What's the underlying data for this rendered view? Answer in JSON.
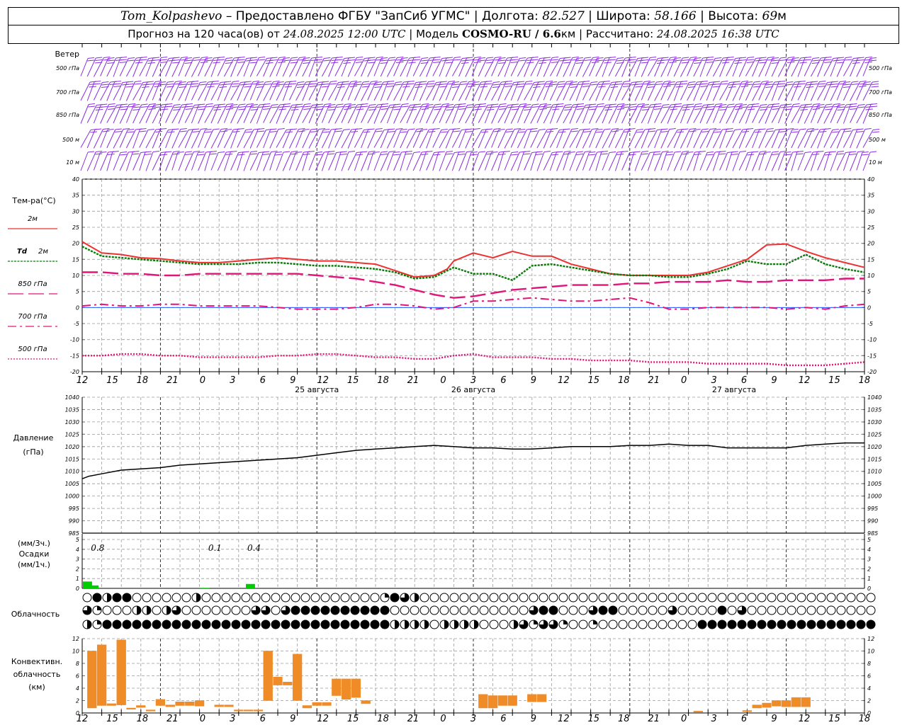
{
  "header": {
    "station": "Tom_Kolpashevo",
    "provider": " – Предоставлено ФГБУ \"ЗапСиб УГМС\" | Долгота: ",
    "lon": "82.527",
    "lat_label": " | Широта: ",
    "lat": "58.166",
    "alt_label": " | Высота: ",
    "alt": "69",
    "alt_unit": "м",
    "fc_label": "Прогноз на 120 часа(ов) от ",
    "fc_start": "24.08.2025 12:00 UTC",
    "model_label": " | Модель ",
    "model": "COSMO-RU / 6.6",
    "model_unit": "км",
    "calc_label": " | Рассчитано: ",
    "calc_time": "24.08.2025 16:38 UTC"
  },
  "colors": {
    "wind": "#8a2be2",
    "t2m": "#ee3030",
    "td2m": "#0a7a0a",
    "t850": "#e0147a",
    "t700": "#e0147a",
    "t500": "#e0147a",
    "pressure": "#000000",
    "precip": "#00cc00",
    "convective": "#f08c28",
    "zero_line": "#1e5aff"
  },
  "chart_data": [
    {
      "type": "wind_barbs",
      "title": "Ветер",
      "levels": [
        "500 гПа",
        "700 гПа",
        "850 гПа",
        "500 м",
        "10  м"
      ],
      "x_hours": [
        0,
        120
      ]
    },
    {
      "type": "line",
      "title": "Тем-ра(°С)",
      "ylim": [
        -20,
        40
      ],
      "ytick_step": 5,
      "x_tick_labels": [
        "12",
        "15",
        "18",
        "21",
        "0",
        "3",
        "6",
        "9",
        "12",
        "15",
        "18",
        "21",
        "0",
        "3",
        "6",
        "9",
        "12",
        "15",
        "18",
        "21",
        "0",
        "3",
        "6",
        "9",
        "12",
        "15",
        "18"
      ],
      "dates": [
        {
          "label": "25 августа",
          "hour": 36
        },
        {
          "label": "26 августа",
          "hour": 60
        },
        {
          "label": "27 августа",
          "hour": 100
        }
      ],
      "legend": [
        {
          "label": "2м",
          "prefix": ""
        },
        {
          "label": "2м",
          "prefix": "Td"
        },
        {
          "label": "850 гПа",
          "prefix": ""
        },
        {
          "label": "700 гПа",
          "prefix": ""
        },
        {
          "label": "500 гПа",
          "prefix": ""
        }
      ],
      "series": [
        {
          "name": "2м",
          "x": [
            0,
            3,
            6,
            9,
            12,
            15,
            18,
            21,
            24,
            27,
            30,
            33,
            36,
            39,
            42,
            45,
            48,
            51,
            54,
            56,
            57,
            60,
            63,
            66,
            69,
            72,
            75,
            78,
            81,
            84,
            87,
            90,
            93,
            96,
            99,
            102,
            105,
            108,
            111,
            114,
            117,
            120
          ],
          "values": [
            20.5,
            17,
            16.5,
            15.5,
            15.2,
            14.5,
            14,
            14,
            14.5,
            15,
            15.5,
            15,
            14.5,
            14.5,
            14,
            13.5,
            11.5,
            9.5,
            10,
            12,
            14.5,
            17,
            15.5,
            17.5,
            16,
            16,
            13.5,
            12,
            10.5,
            10,
            10,
            10,
            10,
            11,
            13,
            15,
            19.5,
            19.8,
            17.5,
            15.5,
            14,
            12.5
          ]
        },
        {
          "name": "Td 2м",
          "x": [
            0,
            3,
            6,
            9,
            12,
            15,
            18,
            21,
            24,
            27,
            30,
            33,
            36,
            39,
            42,
            45,
            48,
            51,
            54,
            57,
            60,
            63,
            66,
            69,
            72,
            75,
            78,
            81,
            84,
            87,
            90,
            93,
            96,
            99,
            102,
            105,
            108,
            111,
            114,
            117,
            120
          ],
          "values": [
            19,
            16,
            15.5,
            15,
            14.5,
            14,
            13.5,
            13.5,
            13.5,
            14,
            14,
            13.5,
            13,
            13,
            12.5,
            12,
            11,
            9,
            9.5,
            12.5,
            10.5,
            10.5,
            8.5,
            13,
            13.5,
            12.5,
            11.5,
            10.5,
            10,
            10,
            9.5,
            9.5,
            10.5,
            12,
            14.5,
            13.5,
            13.5,
            16.5,
            13.5,
            12,
            11
          ]
        },
        {
          "name": "850 гПа",
          "x": [
            0,
            3,
            6,
            9,
            12,
            15,
            18,
            21,
            24,
            27,
            30,
            33,
            36,
            39,
            42,
            45,
            48,
            51,
            54,
            57,
            60,
            63,
            66,
            69,
            72,
            75,
            78,
            81,
            84,
            87,
            90,
            93,
            96,
            99,
            102,
            105,
            108,
            111,
            114,
            117,
            120
          ],
          "values": [
            11,
            11,
            10.5,
            10.5,
            10,
            10,
            10.5,
            10.5,
            10.5,
            10.5,
            10.5,
            10.5,
            10,
            9.5,
            9,
            8,
            7,
            5.5,
            4,
            3,
            3.5,
            4.5,
            5.5,
            6,
            6.5,
            7,
            7,
            7,
            7.5,
            7.5,
            8,
            8,
            8,
            8.5,
            8,
            8,
            8.5,
            8.5,
            8.5,
            9,
            9
          ]
        },
        {
          "name": "700 гПа",
          "x": [
            0,
            3,
            6,
            9,
            12,
            15,
            18,
            21,
            24,
            27,
            30,
            33,
            36,
            39,
            42,
            45,
            48,
            51,
            54,
            57,
            60,
            63,
            66,
            69,
            72,
            75,
            78,
            81,
            84,
            87,
            90,
            93,
            96,
            99,
            102,
            105,
            108,
            111,
            114,
            117,
            120
          ],
          "values": [
            0.5,
            1,
            0.5,
            0.5,
            1,
            1,
            0.5,
            0.5,
            0.5,
            0.5,
            0,
            -0.5,
            -0.5,
            -0.5,
            0,
            1,
            1,
            0.5,
            -0.5,
            0,
            2,
            2,
            2.5,
            3,
            2.5,
            2,
            2,
            2.5,
            3,
            1.5,
            -0.5,
            -0.5,
            0,
            0,
            0,
            0,
            -0.5,
            0,
            -0.5,
            0.5,
            1
          ]
        },
        {
          "name": "500 гПа",
          "x": [
            0,
            3,
            6,
            9,
            12,
            15,
            18,
            21,
            24,
            27,
            30,
            33,
            36,
            39,
            42,
            45,
            48,
            51,
            54,
            57,
            60,
            63,
            66,
            69,
            72,
            75,
            78,
            81,
            84,
            87,
            90,
            93,
            96,
            99,
            102,
            105,
            108,
            111,
            114,
            117,
            120
          ],
          "values": [
            -15,
            -15,
            -14.5,
            -14.5,
            -15,
            -15,
            -15.5,
            -15.5,
            -15.5,
            -15.5,
            -15,
            -15,
            -14.5,
            -14.5,
            -15,
            -15.5,
            -15.5,
            -16,
            -16,
            -15,
            -14.5,
            -15.5,
            -15.5,
            -15.5,
            -16,
            -16,
            -16.5,
            -16.5,
            -16.5,
            -17,
            -17,
            -17,
            -17.5,
            -17.5,
            -17.5,
            -17.5,
            -18,
            -18,
            -18,
            -17.5,
            -17
          ]
        }
      ]
    },
    {
      "type": "line",
      "title_lines": [
        "Давление",
        "(гПа)"
      ],
      "ylim": [
        985,
        1040
      ],
      "ytick_step": 5,
      "series": [
        {
          "x": [
            0,
            1,
            3,
            6,
            9,
            12,
            15,
            18,
            21,
            24,
            27,
            30,
            33,
            36,
            39,
            42,
            45,
            48,
            51,
            54,
            57,
            60,
            63,
            66,
            69,
            72,
            75,
            78,
            81,
            84,
            87,
            90,
            93,
            96,
            99,
            102,
            105,
            108,
            111,
            114,
            117,
            120
          ],
          "values": [
            1007,
            1008,
            1009,
            1010.5,
            1011,
            1011.5,
            1012.5,
            1013,
            1013.5,
            1014,
            1014.5,
            1015,
            1015.5,
            1016.5,
            1017.5,
            1018.5,
            1019,
            1019.5,
            1020,
            1020.5,
            1020,
            1019.5,
            1019.5,
            1019,
            1019,
            1019.5,
            1020,
            1020,
            1020,
            1020.5,
            1020.5,
            1021,
            1020.5,
            1020.5,
            1019.5,
            1019.5,
            1019.5,
            1019.5,
            1020.5,
            1021,
            1021.5,
            1021.5
          ]
        }
      ]
    },
    {
      "type": "bar",
      "title_lines": [
        "(мм/3ч.)",
        "Осадки",
        "(мм/1ч.)"
      ],
      "ylim": [
        0,
        5
      ],
      "ytick_step": 1,
      "hourly_bars": [
        {
          "x": 0,
          "value": 0.7
        },
        {
          "x": 1,
          "value": 0.3
        },
        {
          "x": 18,
          "value": 0.05
        },
        {
          "x": 25,
          "value": 0.45
        }
      ],
      "totals": [
        {
          "x": 1.5,
          "label": "0.8"
        },
        {
          "x": 19.5,
          "label": "0.1"
        },
        {
          "x": 25.5,
          "label": "0.4"
        }
      ]
    },
    {
      "type": "cloud_symbols",
      "title": "Облачность",
      "rows": [
        "0 8 4 8 8 0 0 0 0 0 0 4 0 0 0 0 0 0 0 0 0 0 0 0 0 0 0 0 0 0 3 8 6 4 0 0 0 0 0 0 0 0 0 0 0 0 0 0 0 0 0 0 0 0 0 0 0 0 0 0 0 0 0 0 0 0 0 0 0 0 0 0 0 0 0 0 0 0 0 0 0",
        "6 3 0 0 0 4 4 0 4 6 0 0 0 0 0 0 0 6 6 0 6 8 8 8 8 8 8 8 8 8 8 0 0 0 0 0 0 0 0 0 0 0 0 0 0 6 8 8 0 0 0 6 8 8 0 0 0 0 0 6 0 0 0 0 8 0 6 0 0 0 0 0 0 0 0 0 0 0 0 0 0",
        "4 3 8 8 8 8 8 8 8 8 8 8 8 8 8 8 8 8 8 8 8 8 8 8 8 8 8 8 8 8 8 4 4 4 4 0 4 4 4 4 0 0 0 4 6 3 6 6 3 0 0 3 0 0 0 0 0 0 0 0 0 0 8 8 8 8 8 8 8 8 8 8 8 8 8 8 8 8 8 8 8 8 8 8 8 8 8 8 8 8 8 8 8"
      ]
    },
    {
      "type": "bar",
      "title_lines": [
        "Конвективн.",
        "облачность",
        "(км)"
      ],
      "ylim": [
        0,
        12
      ],
      "ytick_step": 2,
      "bars": [
        {
          "x": 1,
          "base": 0.8,
          "top": 10
        },
        {
          "x": 2,
          "base": 1.2,
          "top": 11
        },
        {
          "x": 3,
          "base": 1.2,
          "top": 1.5
        },
        {
          "x": 4,
          "base": 1.3,
          "top": 11.8
        },
        {
          "x": 5,
          "base": 0.6,
          "top": 0.8
        },
        {
          "x": 6,
          "base": 0.9,
          "top": 1.2
        },
        {
          "x": 7,
          "base": 0.3,
          "top": 0.5
        },
        {
          "x": 8,
          "base": 1.2,
          "top": 2.2
        },
        {
          "x": 9,
          "base": 1,
          "top": 1.3
        },
        {
          "x": 10,
          "base": 1.2,
          "top": 1.8
        },
        {
          "x": 11,
          "base": 1.2,
          "top": 1.8
        },
        {
          "x": 12,
          "base": 1.1,
          "top": 2
        },
        {
          "x": 14,
          "base": 1,
          "top": 1.3
        },
        {
          "x": 15,
          "base": 1,
          "top": 1.3
        },
        {
          "x": 16,
          "base": 0.3,
          "top": 0.5
        },
        {
          "x": 17,
          "base": 0.3,
          "top": 0.5
        },
        {
          "x": 18,
          "base": 0.3,
          "top": 0.5
        },
        {
          "x": 19,
          "base": 2,
          "top": 10
        },
        {
          "x": 20,
          "base": 4.5,
          "top": 5.8
        },
        {
          "x": 21,
          "base": 4.5,
          "top": 5
        },
        {
          "x": 22,
          "base": 2,
          "top": 9.5
        },
        {
          "x": 23,
          "base": 0.8,
          "top": 1.2
        },
        {
          "x": 24,
          "base": 1.2,
          "top": 1.7
        },
        {
          "x": 25,
          "base": 1.2,
          "top": 1.7
        },
        {
          "x": 26,
          "base": 2.8,
          "top": 5.5
        },
        {
          "x": 27,
          "base": 2.2,
          "top": 5.5
        },
        {
          "x": 28,
          "base": 2.5,
          "top": 5.5
        },
        {
          "x": 29,
          "base": 1.5,
          "top": 2
        },
        {
          "x": 41,
          "base": 0.8,
          "top": 3
        },
        {
          "x": 42,
          "base": 0.8,
          "top": 2.8
        },
        {
          "x": 43,
          "base": 1.2,
          "top": 2.8
        },
        {
          "x": 44,
          "base": 1.2,
          "top": 2.8
        },
        {
          "x": 46,
          "base": 1.8,
          "top": 3
        },
        {
          "x": 47,
          "base": 1.8,
          "top": 3
        },
        {
          "x": 63,
          "base": 0.2,
          "top": 0.3
        },
        {
          "x": 68,
          "base": 0.2,
          "top": 0.4
        },
        {
          "x": 69,
          "base": 0.8,
          "top": 1.3
        },
        {
          "x": 70,
          "base": 0.9,
          "top": 1.6
        },
        {
          "x": 71,
          "base": 1.1,
          "top": 2
        },
        {
          "x": 72,
          "base": 1,
          "top": 2
        },
        {
          "x": 73,
          "base": 1,
          "top": 2.5
        },
        {
          "x": 74,
          "base": 1,
          "top": 2.5
        }
      ]
    }
  ]
}
